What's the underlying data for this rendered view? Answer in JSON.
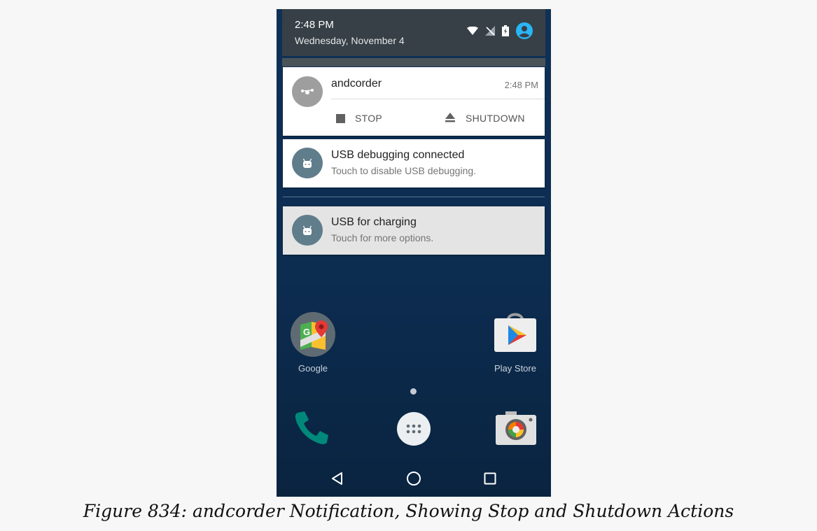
{
  "status_bar": {
    "time": "2:48 PM",
    "date": "Wednesday, November 4",
    "icons": [
      "wifi-icon",
      "no-signal-icon",
      "battery-charging-icon",
      "account-icon"
    ]
  },
  "notifications": [
    {
      "app": "andcorder",
      "time": "2:48 PM",
      "icon": "andcorder-icon",
      "actions": [
        {
          "label": "STOP",
          "icon": "stop-icon"
        },
        {
          "label": "SHUTDOWN",
          "icon": "eject-icon"
        }
      ]
    },
    {
      "title": "USB debugging connected",
      "subtitle": "Touch to disable USB debugging.",
      "icon": "android-icon"
    },
    {
      "title": "USB for charging",
      "subtitle": "Touch for more options.",
      "icon": "android-icon"
    }
  ],
  "home_screen": {
    "apps": [
      {
        "label": "Google",
        "icon": "google-maps-icon"
      },
      {
        "label": "Play Store",
        "icon": "play-store-icon"
      }
    ],
    "dock": [
      "phone-icon",
      "app-drawer-icon",
      "camera-icon"
    ]
  },
  "nav_bar": [
    "back-icon",
    "home-icon",
    "recents-icon"
  ],
  "caption": "Figure 834: andcorder Notification, Showing Stop and Shutdown Actions"
}
